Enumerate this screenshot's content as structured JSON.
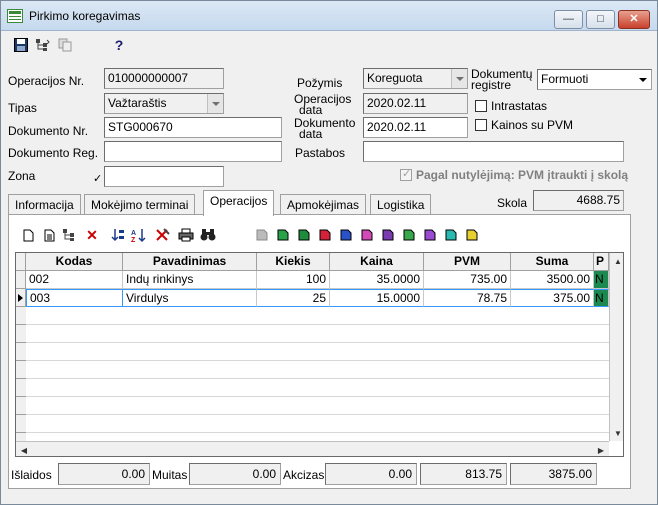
{
  "window": {
    "title": "Pirkimo koregavimas",
    "min": "—",
    "max": "□",
    "close": "✕"
  },
  "toolbar": {
    "save_icon": "floppy-disk-icon",
    "tree_icon": "tree-icon",
    "copy_icon": "copy-icon",
    "help_icon": "help-icon",
    "help_glyph": "?"
  },
  "form": {
    "operacijos_nr": {
      "label": "Operacijos Nr.",
      "value": "010000000007"
    },
    "tipas": {
      "label": "Tipas",
      "value": "Važtaraštis"
    },
    "dokumento_nr": {
      "label": "Dokumento Nr.",
      "value": "STG000670"
    },
    "dokumento_reg": {
      "label": "Dokumento Reg.",
      "value": ""
    },
    "zona": {
      "label": "Zona",
      "value": ""
    },
    "pozymis": {
      "label": "Požymis",
      "value": "Koreguota"
    },
    "operacijos_data": {
      "label1": "Operacijos",
      "label2": "data",
      "value": "2020.02.11"
    },
    "dokumento_data": {
      "label1": "Dokumento",
      "label2": "data",
      "value": "2020.02.11"
    },
    "pastabos": {
      "label": "Pastabos",
      "value": ""
    },
    "dokumentu_registre": {
      "label1": "Dokumentų",
      "label2": "registre",
      "value": "Formuoti"
    },
    "intrastatas": {
      "label": "Intrastatas",
      "checked": false
    },
    "kainos_su_pvm": {
      "label": "Kainos su PVM",
      "checked": false
    },
    "pagal_nutylejima": {
      "label": "Pagal nutylėjimą: PVM įtraukti į skolą",
      "checked": true
    },
    "skola": {
      "label": "Skola",
      "value": "4688.75"
    }
  },
  "tabs": [
    {
      "label": "Informacija",
      "active": false
    },
    {
      "label": "Mokėjimo terminai",
      "active": false
    },
    {
      "label": "Operacijos",
      "active": true
    },
    {
      "label": "Apmokėjimas",
      "active": false
    },
    {
      "label": "Logistika",
      "active": false
    }
  ],
  "grid": {
    "columns": [
      "Kodas",
      "Pavadinimas",
      "Kiekis",
      "Kaina",
      "PVM",
      "Suma",
      "P"
    ],
    "rows": [
      {
        "kodas": "002",
        "pavadinimas": "Indų rinkinys",
        "kiekis": "100",
        "kaina": "35.0000",
        "pvm": "735.00",
        "suma": "3500.00",
        "p": "N"
      },
      {
        "kodas": "003",
        "pavadinimas": "Virdulys",
        "kiekis": "25",
        "kaina": "15.0000",
        "pvm": "78.75",
        "suma": "375.00",
        "p": "N"
      }
    ]
  },
  "footer": {
    "islaidos": {
      "label": "Išlaidos",
      "value": "0.00"
    },
    "muitas": {
      "label": "Muitas",
      "value": "0.00"
    },
    "akcizas": {
      "label": "Akcizas",
      "value": "0.00"
    },
    "pvm_total": "813.75",
    "suma_total": "3875.00"
  },
  "colors": {
    "accent": "#1c7a4a",
    "row_selected_border": "#3399ff",
    "p_cell": "#1c8a50"
  }
}
